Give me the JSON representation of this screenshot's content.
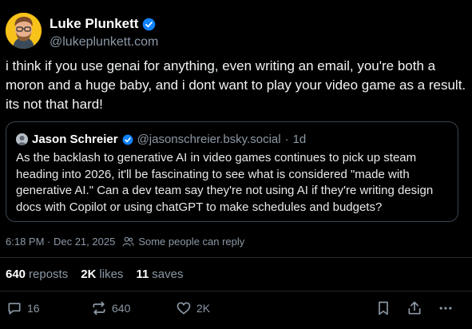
{
  "author": {
    "display_name": "Luke Plunkett",
    "handle": "@lukeplunkett.com",
    "verified": true
  },
  "post": {
    "text": "i think if you use genai for anything, even writing an email, you're both a moron and a huge baby, and i dont want to play your video game as a result. its not that hard!"
  },
  "quote": {
    "display_name": "Jason Schreier",
    "handle": "@jasonschreier.bsky.social",
    "separator": "·",
    "age": "1d",
    "text": "As the backlash to generative AI in video games continues to pick up steam heading into 2026, it'll be fascinating to see what is considered \"made with generative AI.\" Can a dev team say they're not using AI if they're writing design docs with Copilot or using chatGPT to make schedules and budgets?"
  },
  "meta": {
    "timestamp": "6:18 PM · Dec 21, 2025",
    "reply_restriction": "Some people can reply"
  },
  "stats": {
    "reposts_count": "640",
    "reposts_label": "reposts",
    "likes_count": "2K",
    "likes_label": "likes",
    "saves_count": "11",
    "saves_label": "saves"
  },
  "actions": {
    "reply_count": "16",
    "repost_count": "640",
    "like_count": "2K",
    "icons": [
      "reply-icon",
      "repost-icon",
      "like-icon",
      "bookmark-icon",
      "share-icon",
      "more-icon"
    ]
  },
  "colors": {
    "background": "#000000",
    "verified_blue": "#1083fe",
    "muted_text": "#8b98a5"
  }
}
